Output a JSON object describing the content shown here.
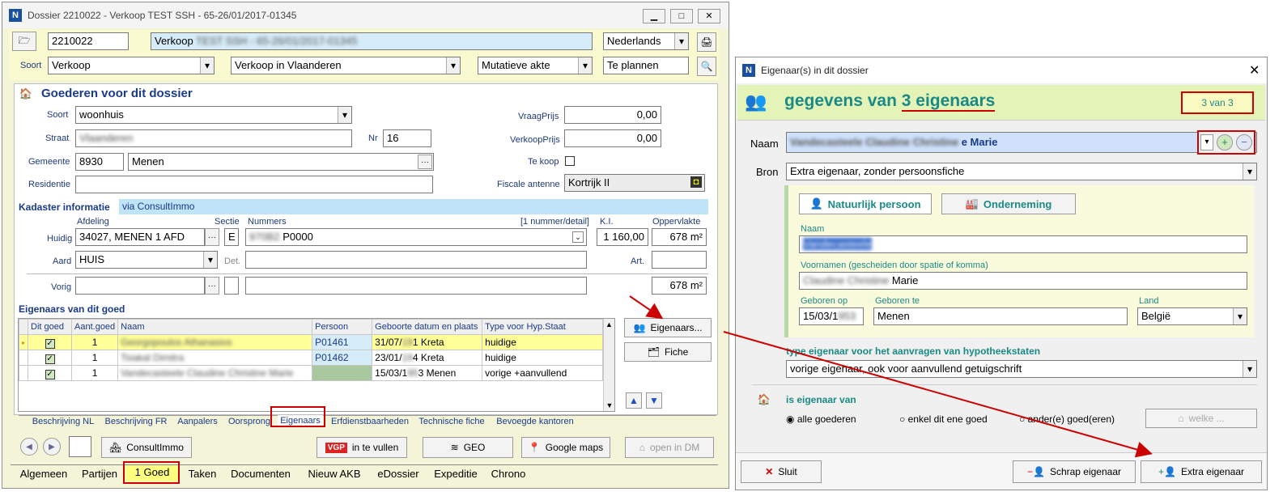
{
  "left": {
    "title": "Dossier 2210022 - Verkoop TEST SSH - 65-26/01/2017-01345",
    "dossier_number": "2210022",
    "dossier_name_prefix": "Verkoop",
    "dossier_name_blur": "TEST SSH - 65-26/01/2017-01345",
    "language": "Nederlands",
    "soort_label": "Soort",
    "soort_value": "Verkoop",
    "region": "Verkoop in Vlaanderen",
    "akte": "Mutatieve akte",
    "status": "Te plannen",
    "section_title": "Goederen voor dit dossier",
    "fields": {
      "soort": "Soort",
      "soort_value": "woonhuis",
      "straat": "Straat",
      "straat_value": "Vlaanderen",
      "nr": "Nr",
      "nr_value": "16",
      "gemeente": "Gemeente",
      "postcode": "8930",
      "gemeente_value": "Menen",
      "residentie": "Residentie",
      "vraagprijs": "VraagPrijs",
      "vraagprijs_value": "0,00",
      "verkoopprijs": "VerkoopPrijs",
      "verkoopprijs_value": "0,00",
      "tekoop": "Te koop",
      "fiscale": "Fiscale antenne",
      "fiscale_value": "Kortrijk II"
    },
    "kadaster": {
      "title": "Kadaster informatie",
      "via": "via ConsultImmo",
      "afdeling": "Afdeling",
      "sectie": "Sectie",
      "nummers": "Nummers",
      "nummer_detail": "[1 nummer/detail]",
      "ki": "K.I.",
      "oppervlakte": "Oppervlakte",
      "huidig": "Huidig",
      "huidig_afdeling": "34027, MENEN  1 AFD",
      "huidig_sectie": "E",
      "huidig_nummer_blur": "970B2",
      "huidig_nummer": "P0000",
      "huidig_ki": "1 160,00",
      "huidig_opp": "678 m²",
      "aard": "Aard",
      "aard_value": "HUIS",
      "det": "Det.",
      "art": "Art.",
      "vorig": "Vorig",
      "vorig_opp": "678 m²"
    },
    "owners": {
      "title": "Eigenaars van dit goed",
      "columns": [
        "Dit goed",
        "Aant.goed",
        "Naam",
        "Persoon",
        "Geboorte datum en plaats",
        "Type voor Hyp.Staat"
      ],
      "rows": [
        {
          "aant": "1",
          "naam": "Georgopoulos Athanasios",
          "persoon": "P01461",
          "geb_a": "31/07/",
          "geb_b": "1 Kreta",
          "type": "huidige"
        },
        {
          "aant": "1",
          "naam": "Tsiakal Dimitra",
          "persoon": "P01462",
          "geb_a": "23/01/",
          "geb_b": "4 Kreta",
          "type": "huidige"
        },
        {
          "aant": "1",
          "naam": "Vandecasteele Claudine Christine Marie",
          "persoon": "",
          "geb_a": "15/03/1",
          "geb_b": "3 Menen",
          "type": "vorige +aanvullend"
        }
      ]
    },
    "btn_eigenaars": "Eigenaars...",
    "btn_fiche": "Fiche",
    "subtabs": [
      "Beschrijving NL",
      "Beschrijving FR",
      "Aanpalers",
      "Oorsprong",
      "Eigenaars",
      "Erfdienstbaarheden",
      "Technische fiche",
      "Bevoegde kantoren"
    ],
    "bottom_buttons": {
      "consult": "ConsultImmo",
      "vgp": "VGP",
      "invullen": "in te vullen",
      "geo": "GEO",
      "gmaps": "Google maps",
      "dm": "open in DM"
    },
    "main_tabs": [
      "Algemeen",
      "Partijen",
      "1 Goed",
      "Taken",
      "Documenten",
      "Nieuw AKB",
      "eDossier",
      "Expeditie",
      "Chrono"
    ]
  },
  "right": {
    "title": "Eigenaar(s) in dit dossier",
    "heading_prefix": "gegevens van",
    "heading_link": "3 eigenaars",
    "counter": "3 van 3",
    "naam_label": "Naam",
    "naam_blur": "Vandecasteele Claudine Christine",
    "naam_suffix": "e Marie",
    "bron_label": "Bron",
    "bron_value": "Extra eigenaar, zonder persoonsfiche",
    "tab_natuurlijk": "Natuurlijk persoon",
    "tab_onderneming": "Onderneming",
    "naam_field_label": "Naam",
    "naam_field_blur": "Vandecasteele",
    "voornamen_label": "Voornamen (gescheiden door spatie of komma)",
    "voornamen_blur": "Claudine Christine",
    "voornamen_suffix": "Marie",
    "geboren_op_label": "Geboren op",
    "geboren_op": "15/03/1",
    "geboren_op_blur": "953",
    "geboren_te_label": "Geboren te",
    "geboren_te": "Menen",
    "land_label": "Land",
    "land": "België",
    "type_label": "type eigenaar voor het aanvragen van hypotheekstaten",
    "type_value": "vorige eigenaar, ook voor aanvullend getuigschrift",
    "is_eigenaar": "is eigenaar van",
    "radio_alle": "alle goederen",
    "radio_enkel": "enkel dit ene goed",
    "radio_ander": "ander(e) goed(eren)",
    "welke": "welke ...",
    "sluit": "Sluit",
    "schrap": "Schrap eigenaar",
    "extra": "Extra eigenaar"
  },
  "colors": {
    "accent_blue": "#1a3a8a",
    "panel_yellow": "#fafadc",
    "highlight_red": "#cc0000",
    "teal": "#1b8a86"
  }
}
